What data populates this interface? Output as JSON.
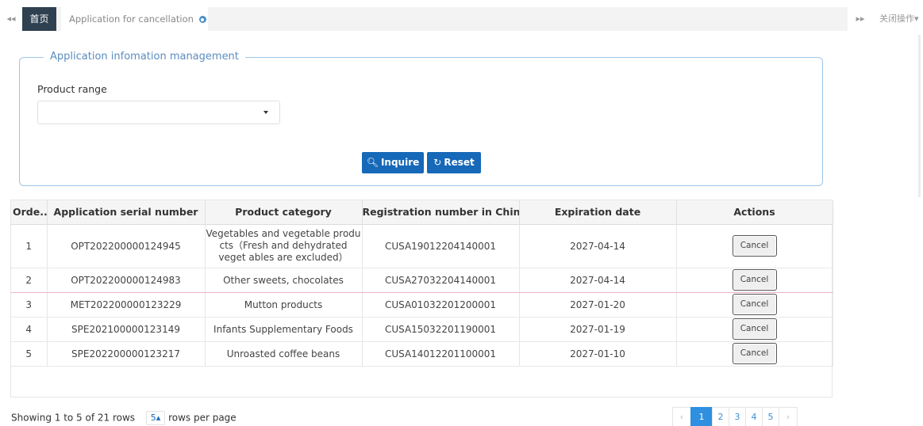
{
  "tabbar": {
    "nav_left": "◂◂",
    "home_label": "首页",
    "active_tab_label": "Application for cancellation",
    "nav_right": "▸▸",
    "ops_label": "关闭操作▾"
  },
  "panel": {
    "legend": "Application infomation management",
    "product_range_label": "Product range",
    "product_range_value": "",
    "inquire_label": "Inquire",
    "reset_label": "Reset"
  },
  "table": {
    "headers": [
      "Orde...",
      "Application serial number",
      "Product category",
      "Registration number in China",
      "Expiration date",
      "Actions"
    ],
    "rows": [
      {
        "order": "1",
        "serial": "OPT202200000124945",
        "category": "Vegetables and vegetable produ cts（Fresh and dehydrated veget ables are excluded）",
        "reg": "CUSA19012204140001",
        "exp": "2027-04-14",
        "action": "Cancel"
      },
      {
        "order": "2",
        "serial": "OPT202200000124983",
        "category": "Other sweets, chocolates",
        "reg": "CUSA27032204140001",
        "exp": "2027-04-14",
        "action": "Cancel"
      },
      {
        "order": "3",
        "serial": "MET202200000123229",
        "category": "Mutton products",
        "reg": "CUSA01032201200001",
        "exp": "2027-01-20",
        "action": "Cancel"
      },
      {
        "order": "4",
        "serial": "SPE202100000123149",
        "category": "Infants Supplementary Foods",
        "reg": "CUSA15032201190001",
        "exp": "2027-01-19",
        "action": "Cancel"
      },
      {
        "order": "5",
        "serial": "SPE202200000123217",
        "category": "Unroasted coffee beans",
        "reg": "CUSA14012201100001",
        "exp": "2027-01-10",
        "action": "Cancel"
      }
    ]
  },
  "footer": {
    "showing_text": "Showing 1 to 5 of 21 rows",
    "page_size": "5",
    "rows_per_page_text": "rows per page"
  },
  "pagination": {
    "prev": "‹",
    "pages": [
      "1",
      "2",
      "3",
      "4",
      "5"
    ],
    "active_page": "1",
    "next": "›"
  },
  "colors": {
    "primary_button": "#1668b8",
    "home_tab": "#2f4050",
    "panel_border": "#9ec5e8",
    "active_page": "#2f8fe0"
  }
}
